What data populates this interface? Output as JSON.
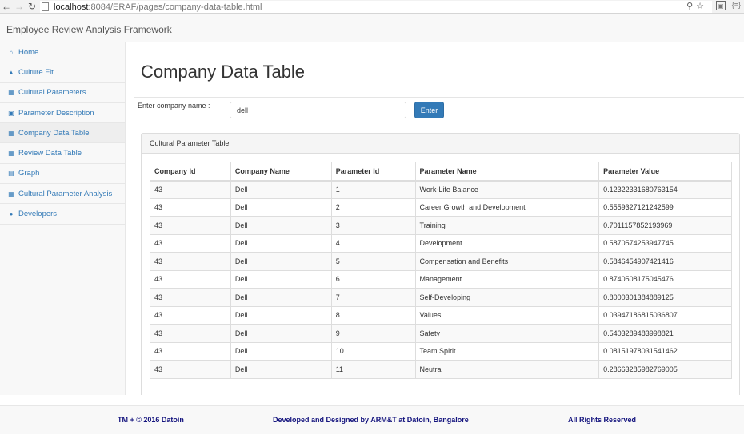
{
  "browser": {
    "url_host": "localhost",
    "url_path": ":8084/ERAF/pages/company-data-table.html"
  },
  "app": {
    "brand": "Employee Review Analysis Framework"
  },
  "sidebar": {
    "items": [
      {
        "label": "Home",
        "icon": "home-icon"
      },
      {
        "label": "Culture Fit",
        "icon": "binoculars-icon"
      },
      {
        "label": "Cultural Parameters",
        "icon": "cubes-icon"
      },
      {
        "label": "Parameter Description",
        "icon": "document-icon"
      },
      {
        "label": "Company Data Table",
        "icon": "table-icon",
        "active": true
      },
      {
        "label": "Review Data Table",
        "icon": "table-icon"
      },
      {
        "label": "Graph",
        "icon": "bar-chart-icon"
      },
      {
        "label": "Cultural Parameter Analysis",
        "icon": "table-icon"
      },
      {
        "label": "Developers",
        "icon": "users-icon"
      }
    ]
  },
  "main": {
    "title": "Company Data Table",
    "form": {
      "label": "Enter company name :",
      "value": "dell",
      "button": "Enter"
    },
    "panel": {
      "heading": "Cultural Parameter Table",
      "columns": [
        "Company Id",
        "Company Name",
        "Parameter Id",
        "Parameter Name",
        "Parameter Value"
      ],
      "rows": [
        [
          "43",
          "Dell",
          "1",
          "Work-Life Balance",
          "0.12322331680763154"
        ],
        [
          "43",
          "Dell",
          "2",
          "Career Growth and Development",
          "0.5559327121242599"
        ],
        [
          "43",
          "Dell",
          "3",
          "Training",
          "0.7011157852193969"
        ],
        [
          "43",
          "Dell",
          "4",
          "Development",
          "0.5870574253947745"
        ],
        [
          "43",
          "Dell",
          "5",
          "Compensation and Benefits",
          "0.5846454907421416"
        ],
        [
          "43",
          "Dell",
          "6",
          "Management",
          "0.8740508175045476"
        ],
        [
          "43",
          "Dell",
          "7",
          "Self-Developing",
          "0.800030138488912 5"
        ],
        [
          "43",
          "Dell",
          "8",
          "Values",
          "0.03947186815036807"
        ],
        [
          "43",
          "Dell",
          "9",
          "Safety",
          "0.5403289483998821"
        ],
        [
          "43",
          "Dell",
          "10",
          "Team Spirit",
          "0.08151978031541462"
        ],
        [
          "43",
          "Dell",
          "11",
          "Neutral",
          "0.28663285982769005"
        ]
      ]
    }
  },
  "footer": {
    "left": "TM + © 2016 Datoin",
    "center": "Developed and Designed by ARM&T at Datoin, Bangalore",
    "right": "All Rights Reserved"
  },
  "colors": {
    "link": "#337ab7",
    "footer_text": "#14147e",
    "button": "#337ab7"
  }
}
